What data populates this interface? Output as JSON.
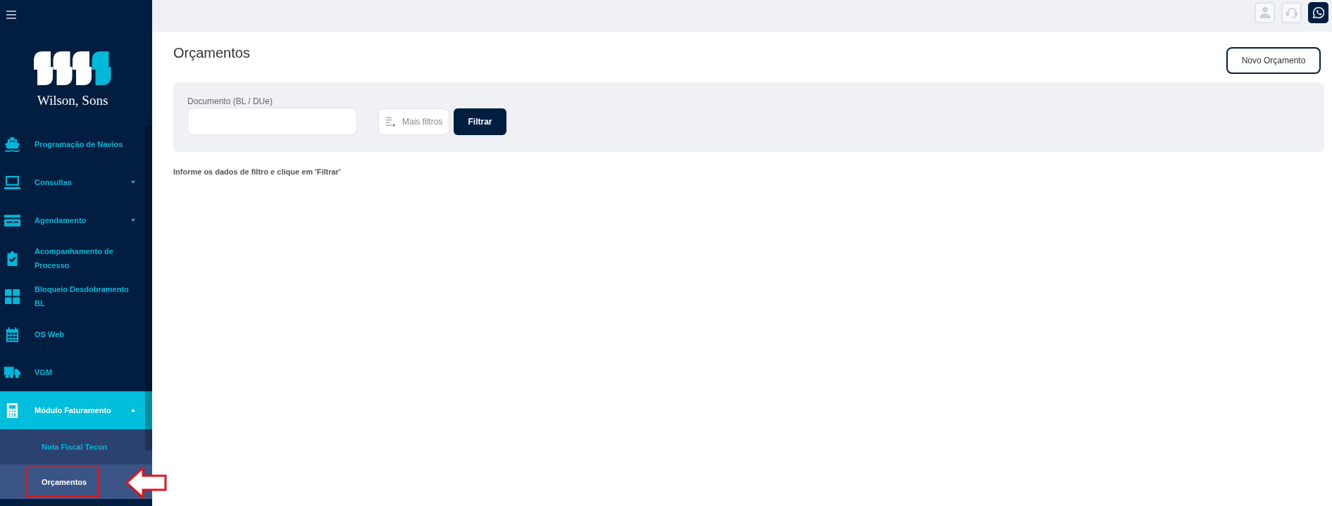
{
  "sidebar": {
    "logo": {
      "wordmark": "Wilson, Sons"
    },
    "items": [
      {
        "label": "Programação de Navios",
        "kind": "link",
        "selected": false
      },
      {
        "label": "Consultas",
        "kind": "group",
        "selected": false,
        "expanded": false
      },
      {
        "label": "Agendamento",
        "kind": "group",
        "selected": false,
        "expanded": false
      },
      {
        "label": "Acompanhamento de Processo",
        "kind": "link",
        "selected": false
      },
      {
        "label": "Bloqueio Desdobramento BL",
        "kind": "link",
        "selected": false
      },
      {
        "label": "OS Web",
        "kind": "link",
        "selected": false
      },
      {
        "label": "VGM",
        "kind": "link",
        "selected": false
      },
      {
        "label": "Módulo Faturamento",
        "kind": "group",
        "selected": true,
        "expanded": true,
        "children": [
          {
            "label": "Nota Fiscal Tecon",
            "selected": false,
            "annotated": false
          },
          {
            "label": "Orçamentos",
            "selected": true,
            "annotated": true
          }
        ]
      }
    ]
  },
  "topbar": {
    "actions": [
      {
        "disabled": true
      },
      {
        "disabled": true
      },
      {
        "disabled": false
      }
    ]
  },
  "page": {
    "title": "Orçamentos",
    "new_button": "Novo Orçamento",
    "filter": {
      "field": {
        "label": "Documento (BL / DUe)"
      },
      "more_filters_button": "Mais filtros",
      "submit_button": "Filtrar"
    },
    "hint": "Informe os dados de filtro e clique em 'Filtrar'"
  }
}
